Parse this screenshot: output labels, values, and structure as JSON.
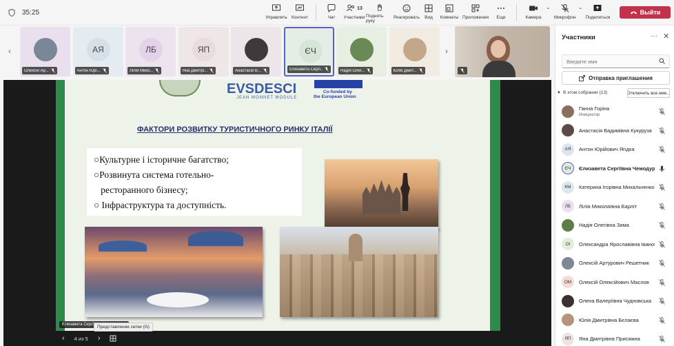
{
  "timer": "35:25",
  "toolbar": [
    {
      "label": "Управлять",
      "icon": "share-screen-icon"
    },
    {
      "label": "Контент",
      "icon": "content-icon"
    },
    {
      "label": "Чат",
      "icon": "chat-icon"
    },
    {
      "label": "Участники",
      "icon": "people-icon",
      "badge": "13"
    },
    {
      "label": "Поднять руку",
      "icon": "raise-hand-icon"
    },
    {
      "label": "Реагировать",
      "icon": "react-icon"
    },
    {
      "label": "Вид",
      "icon": "view-icon"
    },
    {
      "label": "Комнаты",
      "icon": "rooms-icon"
    },
    {
      "label": "Приложения",
      "icon": "apps-icon"
    },
    {
      "label": "Еще",
      "icon": "more-icon"
    },
    {
      "label": "Камера",
      "icon": "camera-icon"
    },
    {
      "label": "Микрофон",
      "icon": "mic-off-icon"
    },
    {
      "label": "Поделиться",
      "icon": "share-icon"
    }
  ],
  "leave_label": "Выйти",
  "thumbnails": [
    {
      "name": "Олексій Ар...",
      "initials": "",
      "bg": "#e9dfee",
      "av": "#7a8796"
    },
    {
      "name": "Антон Юрі...",
      "initials": "АЯ",
      "bg": "#e4ecf1",
      "av": "#d6e0e8"
    },
    {
      "name": "Лілія Мико...",
      "initials": "ЛБ",
      "bg": "#ece3ef",
      "av": "#e2d3ea"
    },
    {
      "name": "Яна Дмитрі...",
      "initials": "ЯП",
      "bg": "#efe7e7",
      "av": "#e9dcdc"
    },
    {
      "name": "Анастасія В...",
      "initials": "",
      "bg": "#ede5ea",
      "av": "#3f3a3a"
    },
    {
      "name": "Єлизавета Сергі...",
      "initials": "ЄЧ",
      "bg": "#e5eee6",
      "av": "#d5e6d7"
    },
    {
      "name": "Надія Олег...",
      "initials": "",
      "bg": "#e7efe3",
      "av": "#6a8a55"
    },
    {
      "name": "Юлія Дмит...",
      "initials": "",
      "bg": "#f1ebe2",
      "av": "#c4a689"
    }
  ],
  "slide": {
    "logo": "EVSDESCI",
    "logo_sub": "JEAN MONNET MODULE",
    "eu_text_1": "Co-funded by",
    "eu_text_2": "the European Union",
    "title": "ФАКТОРИ РОЗВИТКУ ТУРИСТИЧНОГО РИНКУ ІТАЛІЇ",
    "bullets": [
      "○Культурне і історичне багатство;",
      "○Розвинута система готельно-",
      "   ресторанного бізнесу;",
      "○ Інфраструктура та доступність."
    ]
  },
  "presenter_label": "Єлизавета Сергіївна Чемодурова",
  "tooltip": "Представление сетки (G)",
  "pager": "4 из 5",
  "panel": {
    "title": "Участники",
    "search_placeholder": "Введите имя",
    "invite_label": "Отправка приглашения",
    "in_meeting": "В этом собрании (13)",
    "mute_all": "Отключить все мик...",
    "participants": [
      {
        "name": "Ганна Горіна",
        "role": "Инициатор",
        "initials": "",
        "av": "#8a6f5e"
      },
      {
        "name": "Анастасія Вадимівна Кукуруза",
        "role": "",
        "initials": "",
        "av": "#5b4a45"
      },
      {
        "name": "Антон Юрійович Ягідка",
        "role": "",
        "initials": "АЯ",
        "av": "#dde5ec"
      },
      {
        "name": "Єлизавета Сергіївна Чемодурова",
        "role": "",
        "initials": "ЄЧ",
        "av": "#dfeae0"
      },
      {
        "name": "Катерина Ігорівна Михальченко",
        "role": "",
        "initials": "КМ",
        "av": "#dbe8ee"
      },
      {
        "name": "Лілія Миколаївна Барліт",
        "role": "",
        "initials": "ЛБ",
        "av": "#ecdff0"
      },
      {
        "name": "Надія Олегівна Зима",
        "role": "",
        "initials": "",
        "av": "#5c7d46"
      },
      {
        "name": "Олександра Ярославівна Іванова",
        "role": "",
        "initials": "ОІ",
        "av": "#e2edd9"
      },
      {
        "name": "Олексій Артурович Решетник",
        "role": "",
        "initials": "",
        "av": "#7e8795"
      },
      {
        "name": "Олексій Олексійович Маслов",
        "role": "",
        "initials": "ОМ",
        "av": "#f4dcd5"
      },
      {
        "name": "Олена Валеріївна Чудновська",
        "role": "",
        "initials": "",
        "av": "#3a3230"
      },
      {
        "name": "Юлія Дмитрівна Бєлаєва",
        "role": "",
        "initials": "",
        "av": "#b5947a"
      },
      {
        "name": "Яна Дмитрівна Присяжна",
        "role": "",
        "initials": "ЯП",
        "av": "#efe2e2"
      }
    ]
  },
  "colors": {
    "leave": "#c4314b",
    "accent": "#5b5fc7",
    "slide_green": "#2d8a4a",
    "title_navy": "#22306b"
  }
}
